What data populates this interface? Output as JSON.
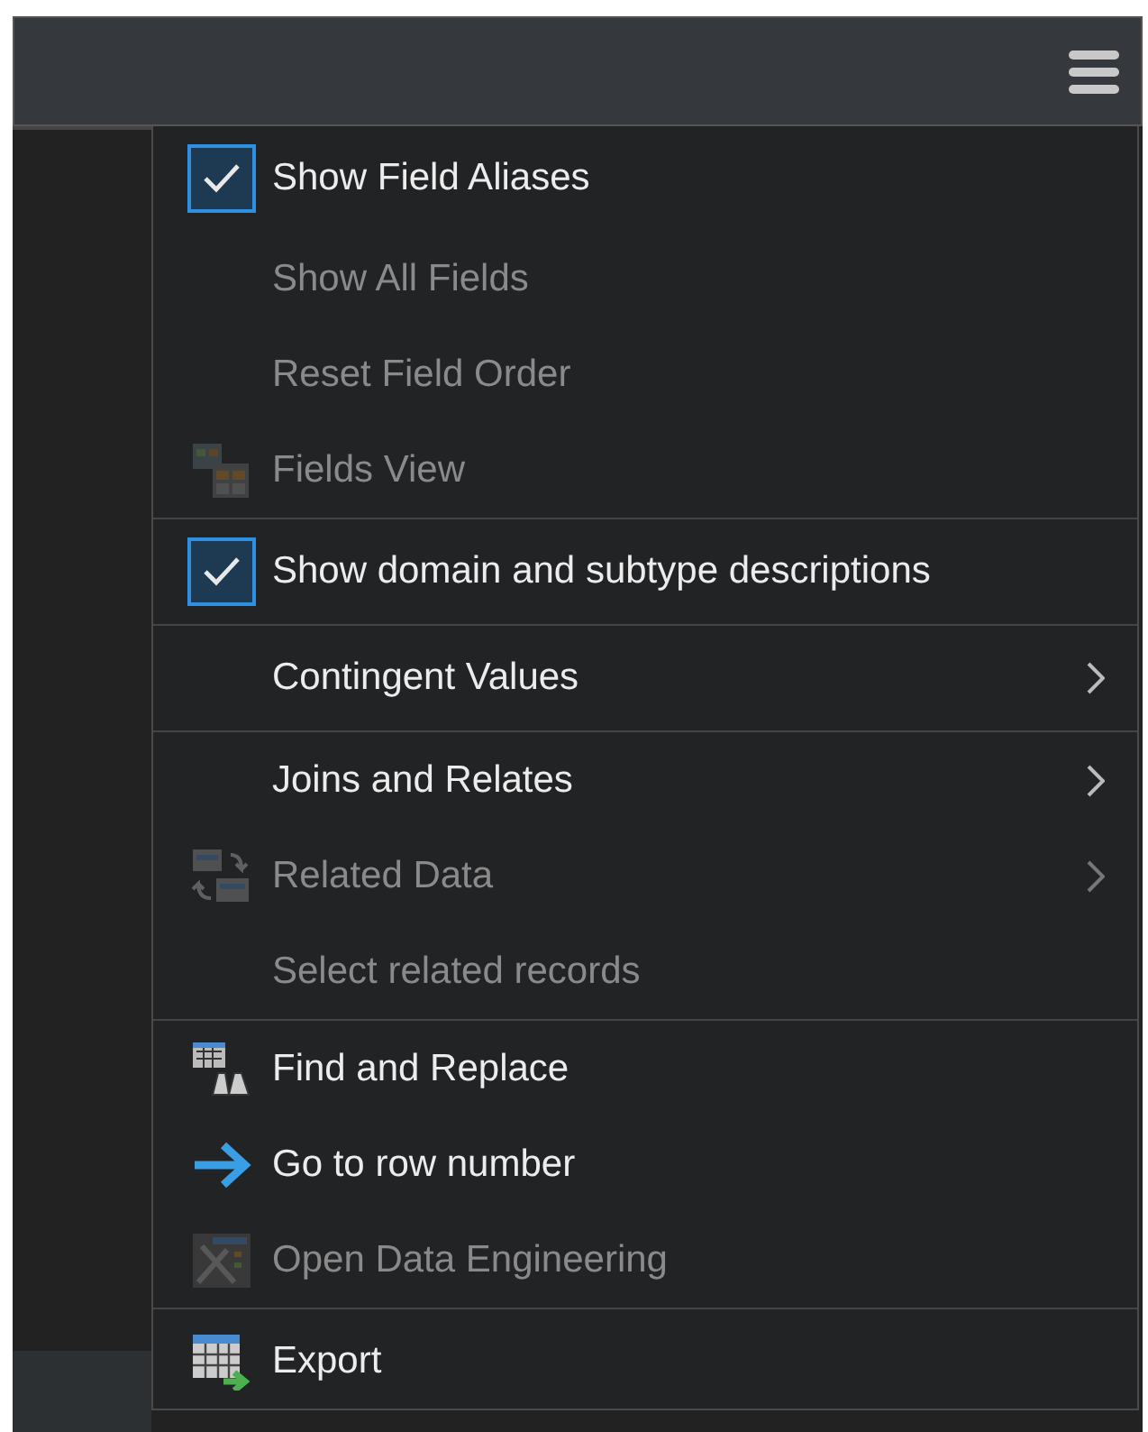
{
  "menu": {
    "groups": [
      {
        "items": [
          {
            "label": "Show Field Aliases",
            "kind": "checkbox",
            "checked": true,
            "disabled": false,
            "submenu": false
          },
          {
            "label": "Show All Fields",
            "kind": "plain",
            "disabled": true,
            "submenu": false
          },
          {
            "label": "Reset Field Order",
            "kind": "plain",
            "disabled": true,
            "submenu": false
          },
          {
            "label": "Fields View",
            "kind": "fields",
            "disabled": true,
            "submenu": false
          }
        ]
      },
      {
        "items": [
          {
            "label": "Show domain and subtype descriptions",
            "kind": "checkbox",
            "checked": true,
            "disabled": false,
            "submenu": false
          }
        ]
      },
      {
        "items": [
          {
            "label": "Contingent Values",
            "kind": "plain",
            "disabled": false,
            "submenu": true
          }
        ]
      },
      {
        "items": [
          {
            "label": "Joins and Relates",
            "kind": "plain",
            "disabled": false,
            "submenu": true
          },
          {
            "label": "Related Data",
            "kind": "related",
            "disabled": true,
            "submenu": true
          },
          {
            "label": "Select related records",
            "kind": "plain",
            "disabled": true,
            "submenu": false
          }
        ]
      },
      {
        "items": [
          {
            "label": "Find and Replace",
            "kind": "find",
            "disabled": false,
            "submenu": false
          },
          {
            "label": "Go to row number",
            "kind": "goto",
            "disabled": false,
            "submenu": false
          },
          {
            "label": "Open Data Engineering",
            "kind": "engineering",
            "disabled": true,
            "submenu": false
          }
        ]
      },
      {
        "items": [
          {
            "label": "Export",
            "kind": "export",
            "disabled": false,
            "submenu": false
          }
        ]
      }
    ]
  }
}
